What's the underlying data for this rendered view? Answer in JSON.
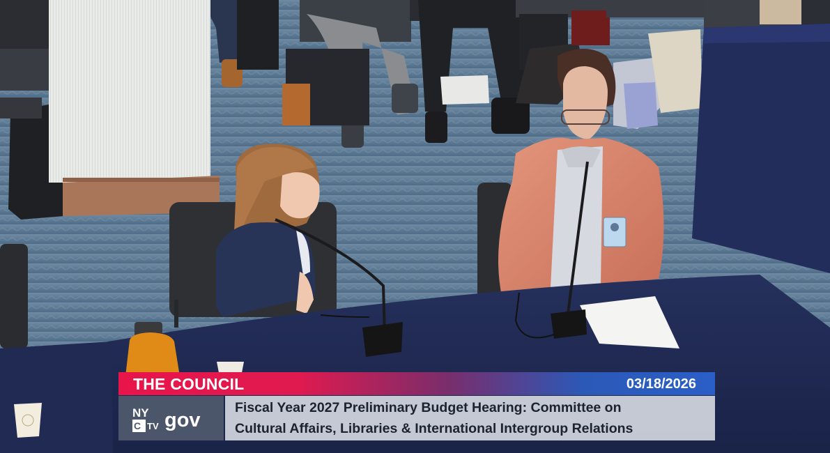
{
  "broadcast": {
    "network": "THE COUNCIL",
    "date": "03/18/2026",
    "logo_text": "gov",
    "logo_mark_text": "NYC TV",
    "title_line1": "Fiscal Year 2027 Preliminary Budget Hearing: Committee on",
    "title_line2": "Cultural Affairs, Libraries & International Intergroup Relations"
  },
  "colors": {
    "banner_red": "#e8154a",
    "banner_blue": "#2a5fc7",
    "carpet": "#5a7790",
    "table_cloth": "#1f2a52"
  },
  "scene": {
    "description_icons": [
      "microphone-icon",
      "microphone-icon",
      "paper-sheet",
      "coffee-cup",
      "orange-thermos"
    ]
  }
}
